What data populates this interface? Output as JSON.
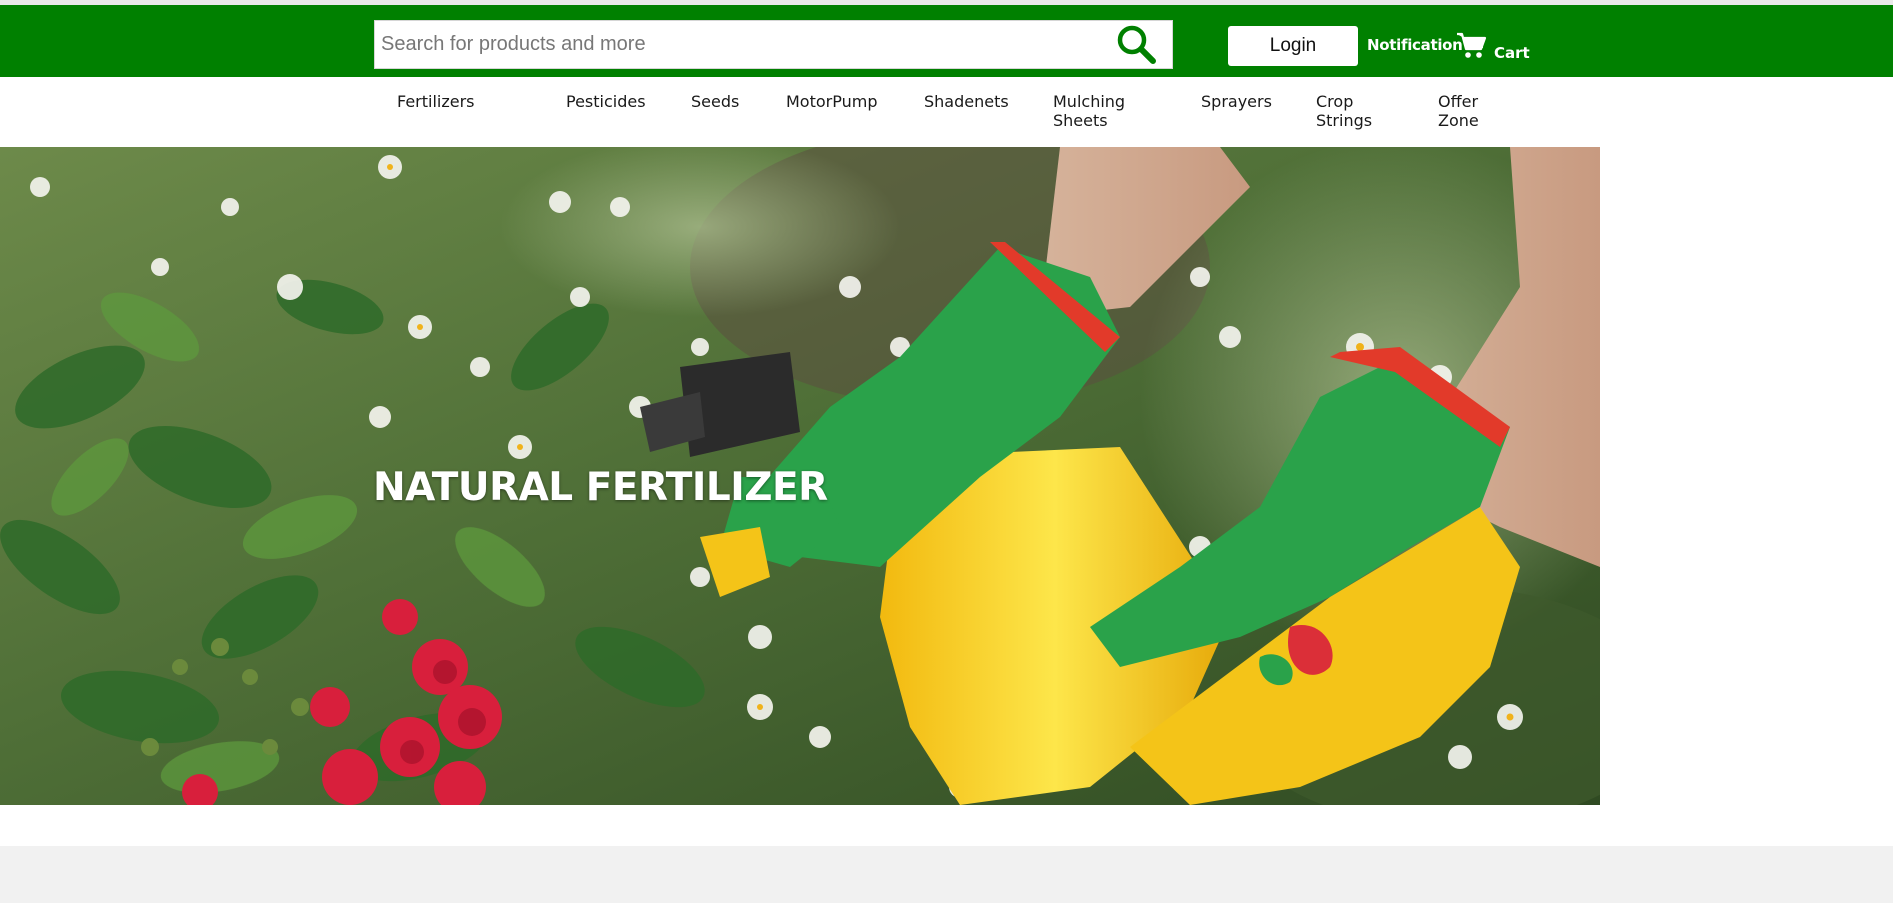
{
  "header": {
    "search": {
      "placeholder": "Search for products and more",
      "value": ""
    },
    "search_icon": "search-icon",
    "login_label": "Login",
    "notification_label": "Notification",
    "cart_icon": "cart-icon",
    "cart_label": "Cart"
  },
  "nav": {
    "items": [
      {
        "label": "Fertilizers"
      },
      {
        "label": "Pesticides"
      },
      {
        "label": "Seeds"
      },
      {
        "label": "MotorPump"
      },
      {
        "label": "Shadenets"
      },
      {
        "label": "Mulching Sheets"
      },
      {
        "label": "Sprayers"
      },
      {
        "label": "Crop Strings"
      },
      {
        "label": "Offer Zone"
      }
    ]
  },
  "hero": {
    "title": "NATURAL FERTILIZER"
  },
  "colors": {
    "header_green": "#008000",
    "nav_background": "#ffffff",
    "footer_band": "#f1f1f1",
    "glove_green": "#2aa24a",
    "glove_yellow": "#f4c418",
    "rose_red": "#d81f3c"
  }
}
